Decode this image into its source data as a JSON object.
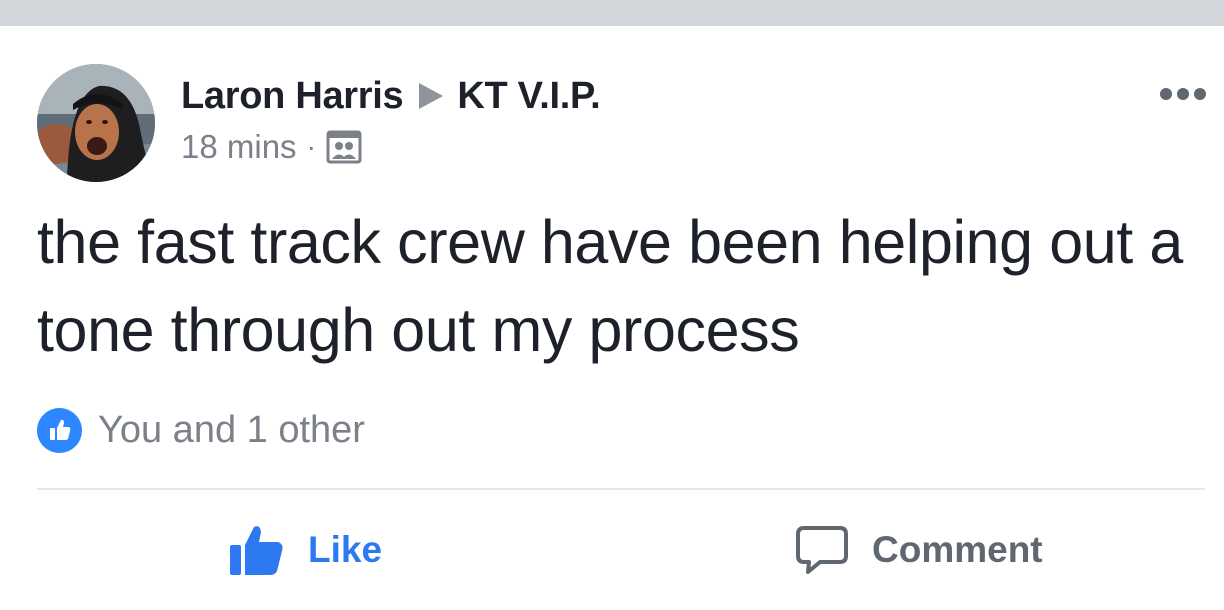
{
  "post": {
    "author": "Laron Harris",
    "group": "KT V.I.P.",
    "timestamp": "18 mins",
    "separator": "·",
    "audience_icon": "group-audience-icon",
    "text": "the fast track crew have been helping out a tone through out my process",
    "reactions": {
      "icon": "like-reaction-icon",
      "summary": "You and 1 other"
    },
    "actions": {
      "like": "Like",
      "comment": "Comment"
    },
    "more_icon": "more-options-icon"
  },
  "colors": {
    "header_bar": "#d3d6db",
    "text_primary": "#1d2129",
    "text_secondary": "#7b8089",
    "like_blue": "#2d79f0",
    "reaction_blue": "#2d88ff",
    "divider": "#e4e6e9"
  }
}
